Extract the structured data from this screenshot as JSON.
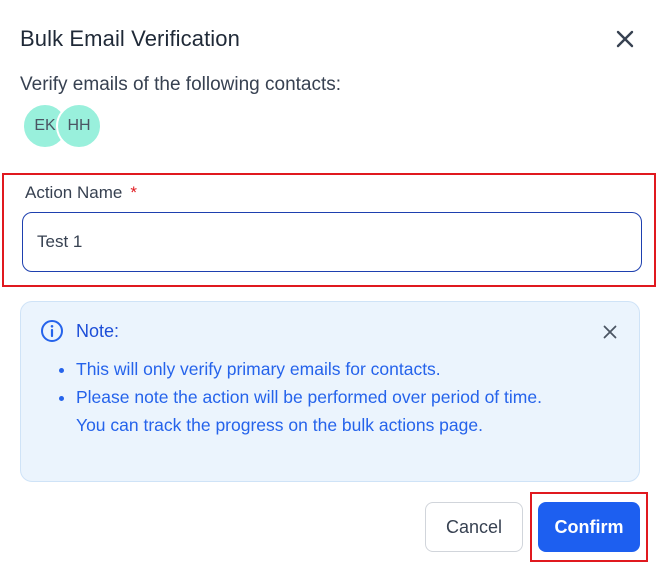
{
  "dialog": {
    "title": "Bulk Email Verification",
    "close_icon": "close-icon"
  },
  "contacts": {
    "heading": "Verify emails of the following contacts:",
    "avatars": [
      {
        "initials": "EK"
      },
      {
        "initials": "HH"
      }
    ],
    "avatar_color": "#99f0dc"
  },
  "action_name": {
    "label": "Action Name",
    "required_marker": "*",
    "value": "Test 1"
  },
  "note": {
    "icon": "info-icon",
    "title": "Note:",
    "items": [
      "This will only verify primary emails for contacts.",
      "Please note the action will be performed over period of time. You can track the progress on the bulk actions page."
    ],
    "close_icon": "close-icon"
  },
  "buttons": {
    "cancel": "Cancel",
    "confirm": "Confirm"
  },
  "colors": {
    "accent": "#1d5ff0",
    "note_text": "#2563eb",
    "note_background": "#ebf4fd",
    "highlight_outline": "#e0191f"
  }
}
